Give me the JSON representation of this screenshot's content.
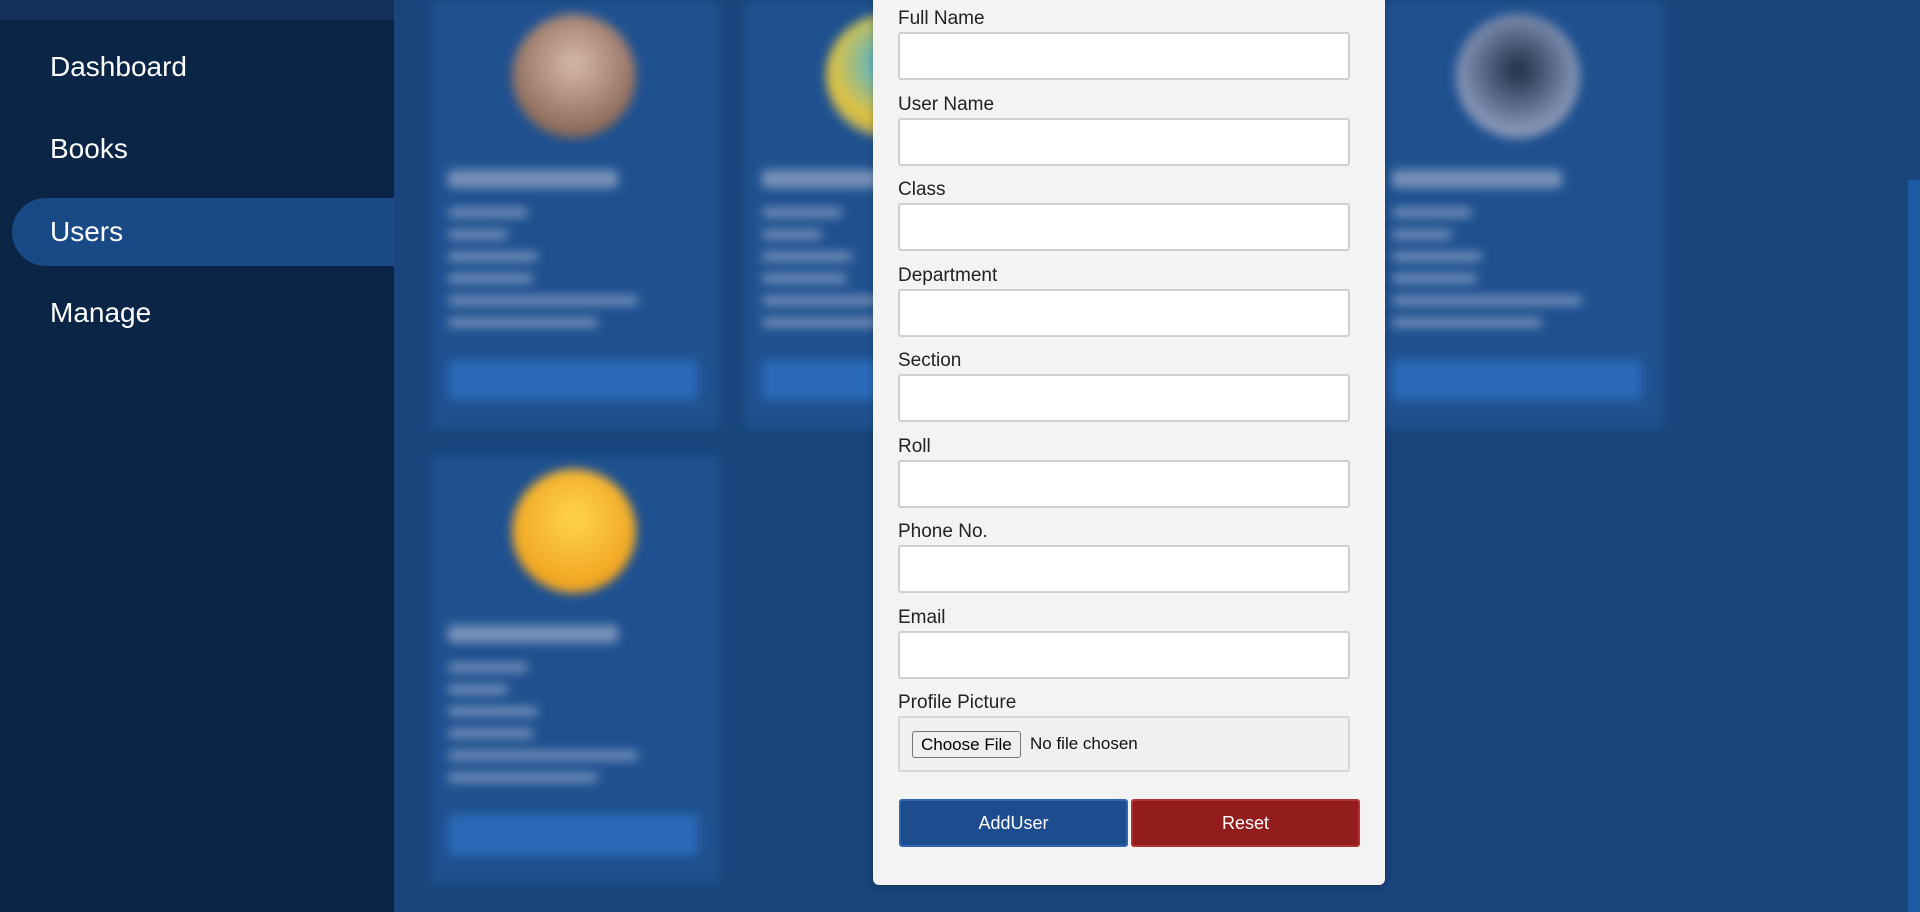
{
  "sidebar": {
    "items": [
      {
        "label": "Dashboard",
        "active": false
      },
      {
        "label": "Books",
        "active": false
      },
      {
        "label": "Users",
        "active": true
      },
      {
        "label": "Manage",
        "active": false
      }
    ]
  },
  "form": {
    "fields": [
      {
        "label": "Full Name",
        "value": ""
      },
      {
        "label": "User Name",
        "value": ""
      },
      {
        "label": "Class",
        "value": ""
      },
      {
        "label": "Department",
        "value": ""
      },
      {
        "label": "Section",
        "value": ""
      },
      {
        "label": "Roll",
        "value": ""
      },
      {
        "label": "Phone No.",
        "value": ""
      },
      {
        "label": "Email",
        "value": ""
      }
    ],
    "profile_picture": {
      "label": "Profile Picture",
      "button": "Choose File",
      "status": "No file chosen"
    },
    "add_button": "AddUser",
    "reset_button": "Reset"
  },
  "colors": {
    "sidebar_bg": "#0b2546",
    "main_bg": "#18457c",
    "add_button": "#1d4d8f",
    "reset_button": "#931c1c"
  }
}
